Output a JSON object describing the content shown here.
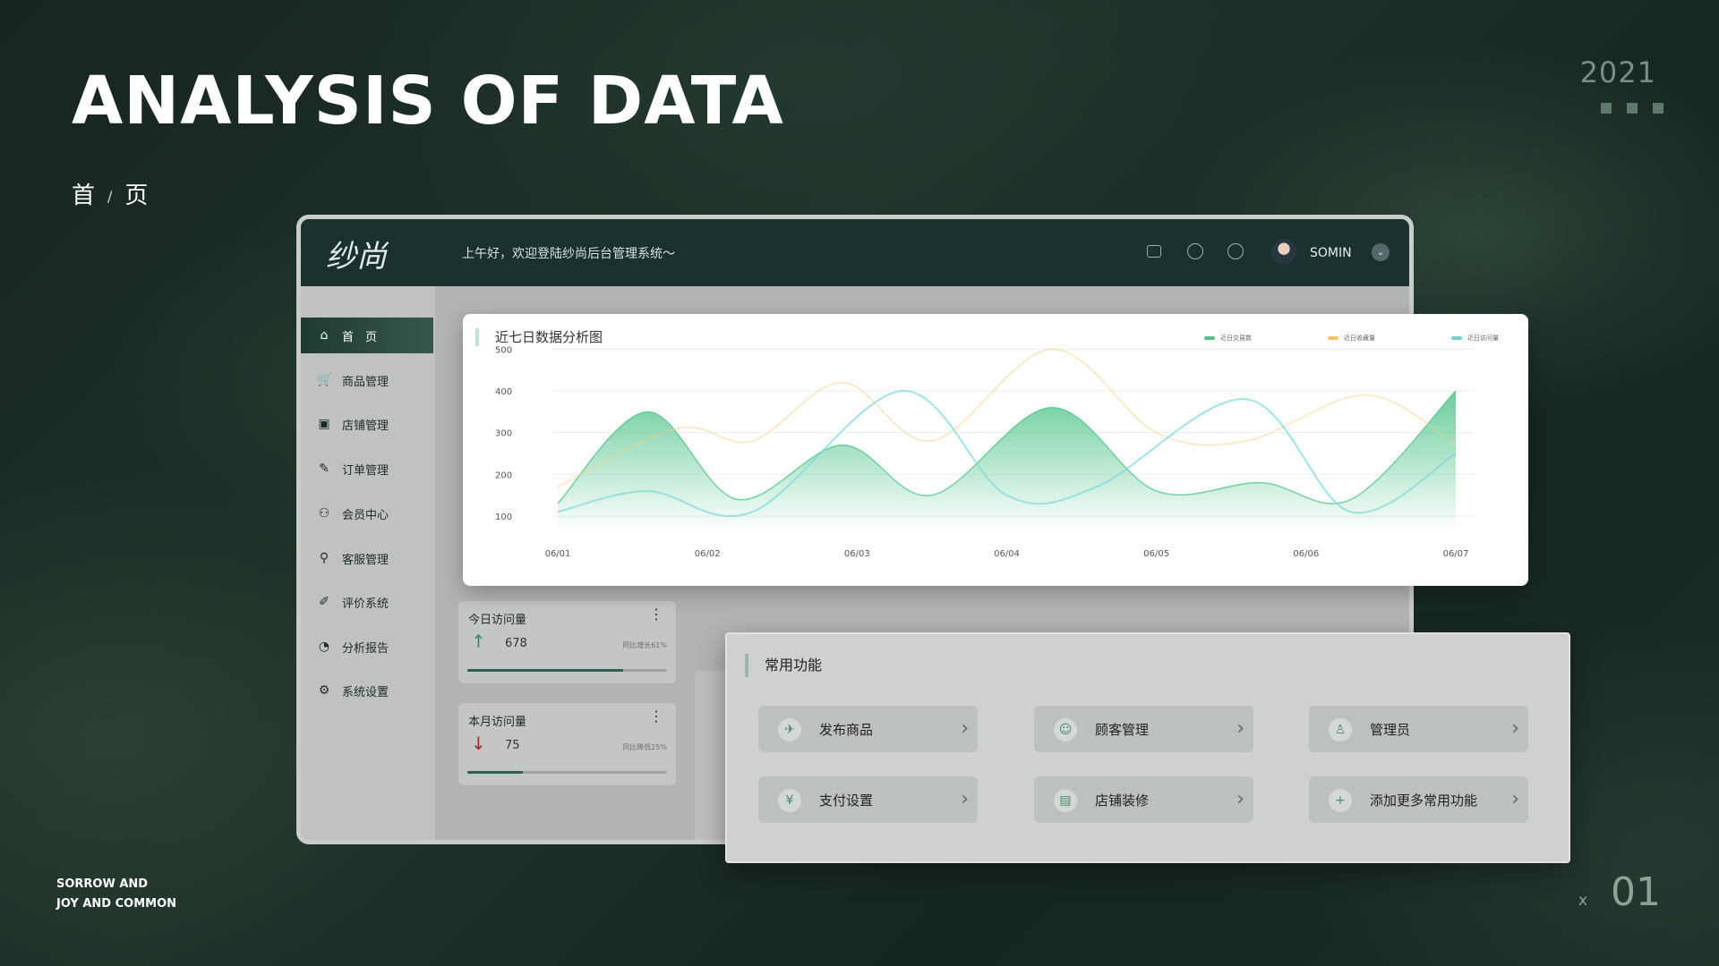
{
  "slide": {
    "title": "ANALYSIS OF DATA",
    "breadcrumb": {
      "first": "首",
      "sep": "/",
      "second": "页"
    },
    "year": "2021",
    "footer_line1": "SORROW AND",
    "footer_line2": "JOY AND COMMON",
    "page_x": "x",
    "page_number": "01"
  },
  "topbar": {
    "logo": "纱尚",
    "greeting": "上午好，欢迎登陆纱尚后台管理系统～",
    "username": "SOMIN"
  },
  "sidebar": {
    "items": [
      {
        "label": "首　页",
        "icon": "home-icon",
        "glyph": "⌂"
      },
      {
        "label": "商品管理",
        "icon": "cart-icon",
        "glyph": "🛒"
      },
      {
        "label": "店铺管理",
        "icon": "store-icon",
        "glyph": "▣"
      },
      {
        "label": "订单管理",
        "icon": "order-edit-icon",
        "glyph": "✎"
      },
      {
        "label": "会员中心",
        "icon": "members-icon",
        "glyph": "⚇"
      },
      {
        "label": "客服管理",
        "icon": "service-user-icon",
        "glyph": "⚲"
      },
      {
        "label": "评价系统",
        "icon": "pencil-icon",
        "glyph": "✐"
      },
      {
        "label": "分析报告",
        "icon": "chat-icon",
        "glyph": "◔"
      },
      {
        "label": "系统设置",
        "icon": "gear-icon",
        "glyph": "⚙"
      }
    ]
  },
  "stats": {
    "today": {
      "label": "今日访问量",
      "value": "678",
      "compare": "同比增长61%",
      "progress": 0.78
    },
    "month": {
      "label": "本月访问量",
      "value": "75",
      "compare": "同比降低25%",
      "progress": 0.28
    }
  },
  "functions": {
    "title": "常用功能",
    "buttons": [
      {
        "label": "发布商品",
        "icon": "send-icon",
        "glyph": "✈"
      },
      {
        "label": "顾客管理",
        "icon": "customer-icon",
        "glyph": "☺"
      },
      {
        "label": "管理员",
        "icon": "admin-icon",
        "glyph": "♙"
      },
      {
        "label": "支付设置",
        "icon": "payment-icon",
        "glyph": "¥"
      },
      {
        "label": "店铺装修",
        "icon": "shop-decor-icon",
        "glyph": "▤"
      },
      {
        "label": "添加更多常用功能",
        "icon": "plus-icon",
        "glyph": "+"
      }
    ]
  },
  "chart_data": {
    "type": "area",
    "title": "近七日数据分析图",
    "categories": [
      "06/01",
      "06/02",
      "06/03",
      "06/04",
      "06/05",
      "06/06",
      "06/07"
    ],
    "yticks": [
      500,
      400,
      300,
      200,
      100
    ],
    "ylim": [
      80,
      520
    ],
    "legend_position": "top-right",
    "series": [
      {
        "name": "近日交易数",
        "color": "#4fc48a",
        "x": [
          0,
          0.6,
          1.2,
          1.9,
          2.5,
          3.3,
          4.0,
          4.7,
          5.3,
          6.0
        ],
        "values": [
          130,
          350,
          140,
          270,
          150,
          360,
          160,
          180,
          140,
          400
        ]
      },
      {
        "name": "近日收藏量",
        "color": "#f5d08a",
        "x": [
          0,
          0.8,
          1.3,
          1.9,
          2.5,
          3.3,
          4.0,
          4.6,
          5.4,
          6.0
        ],
        "values": [
          170,
          310,
          280,
          420,
          280,
          500,
          300,
          280,
          390,
          270
        ]
      },
      {
        "name": "近日访问量",
        "color": "#7fd9dc",
        "x": [
          0,
          0.6,
          1.3,
          2.3,
          3.0,
          3.6,
          4.6,
          5.3,
          6.0
        ],
        "values": [
          110,
          160,
          110,
          400,
          150,
          170,
          380,
          110,
          250
        ]
      }
    ]
  }
}
